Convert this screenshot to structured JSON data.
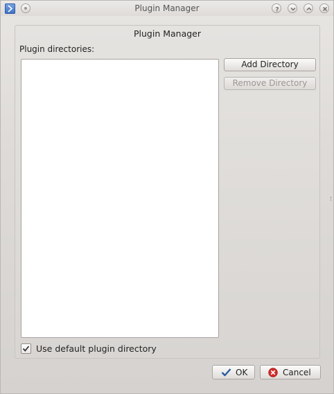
{
  "window": {
    "title": "Plugin Manager",
    "controls": [
      "help-icon",
      "minimize-icon",
      "maximize-icon",
      "close-icon"
    ]
  },
  "group": {
    "title": "Plugin Manager",
    "directories_label": "Plugin directories:",
    "directories": []
  },
  "buttons": {
    "add_directory": "Add Directory",
    "remove_directory": "Remove Directory",
    "ok": "OK",
    "cancel": "Cancel"
  },
  "checkbox": {
    "label": "Use default plugin directory",
    "checked": true
  },
  "colors": {
    "app_icon": "#3c6fc4",
    "ok_check": "#2a5aa0",
    "cancel_icon": "#d42a2a"
  }
}
